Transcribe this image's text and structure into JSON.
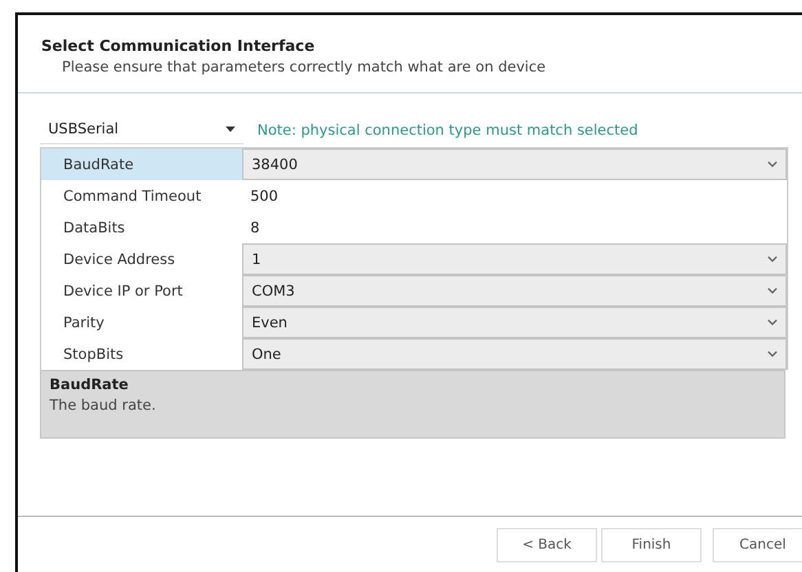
{
  "header": {
    "title": "Select Communication Interface",
    "subtitle": "Please ensure that parameters correctly match what are on device"
  },
  "interface": {
    "value": "USBSerial",
    "note": "Note: physical connection type must match selected"
  },
  "properties": [
    {
      "name": "BaudRate",
      "value": "38400",
      "kind": "dropdown",
      "selected": true
    },
    {
      "name": "Command Timeout",
      "value": "500",
      "kind": "text",
      "selected": false
    },
    {
      "name": "DataBits",
      "value": "8",
      "kind": "text",
      "selected": false
    },
    {
      "name": "Device Address",
      "value": "1",
      "kind": "dropdown",
      "selected": false
    },
    {
      "name": "Device IP or Port",
      "value": "COM3",
      "kind": "dropdown",
      "selected": false
    },
    {
      "name": "Parity",
      "value": "Even",
      "kind": "dropdown",
      "selected": false
    },
    {
      "name": "StopBits",
      "value": "One",
      "kind": "dropdown",
      "selected": false
    }
  ],
  "description": {
    "title": "BaudRate",
    "text": "The baud rate."
  },
  "buttons": [
    "< Back",
    "Finish",
    "Cancel"
  ]
}
